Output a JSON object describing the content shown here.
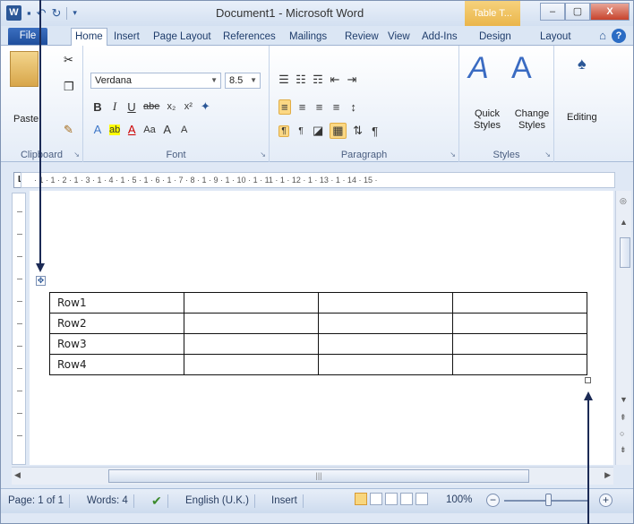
{
  "title_bar": {
    "app_icon": "W",
    "title": "Document1  -  Microsoft Word",
    "context_tab_header": "Table T...",
    "minimize": "–",
    "maximize": "▢",
    "close": "X"
  },
  "tabs": {
    "file": "File",
    "items": [
      "Home",
      "Insert",
      "Page Layout",
      "References",
      "Mailings",
      "Review",
      "View",
      "Add-Ins"
    ],
    "context_items": [
      "Design",
      "Layout"
    ]
  },
  "ribbon": {
    "clipboard": {
      "paste": "Paste",
      "label": "Clipboard"
    },
    "font": {
      "name": "Verdana",
      "size": "8.5",
      "label": "Font"
    },
    "paragraph": {
      "label": "Paragraph"
    },
    "styles": {
      "quick": "Quick Styles",
      "change": "Change Styles",
      "label": "Styles"
    },
    "editing": {
      "label": "Editing"
    }
  },
  "ruler": {
    "corner": "L",
    "text": "· 1 · 1 · 2 · 1 · 3 · 1 · 4 · 1 · 5 · 1 · 6 · 1 · 7 · 8 · 1 · 9 · 1 · 10 · 1 · 11 · 1 · 12 · 1 · 13 · 1 · 14 · 15 ·"
  },
  "table": {
    "rows": [
      [
        "Row1",
        "",
        "",
        ""
      ],
      [
        "Row2",
        "",
        "",
        ""
      ],
      [
        "Row3",
        "",
        "",
        ""
      ],
      [
        "Row4",
        "",
        "",
        ""
      ]
    ]
  },
  "status": {
    "page": "Page: 1 of 1",
    "words": "Words: 4",
    "language": "English (U.K.)",
    "mode": "Insert",
    "zoom": "100%"
  },
  "icons": [
    "word-logo-icon",
    "save-icon",
    "undo-icon",
    "redo-icon",
    "help-icon",
    "table-move-icon",
    "table-resize-icon",
    "spelling-check-icon"
  ]
}
